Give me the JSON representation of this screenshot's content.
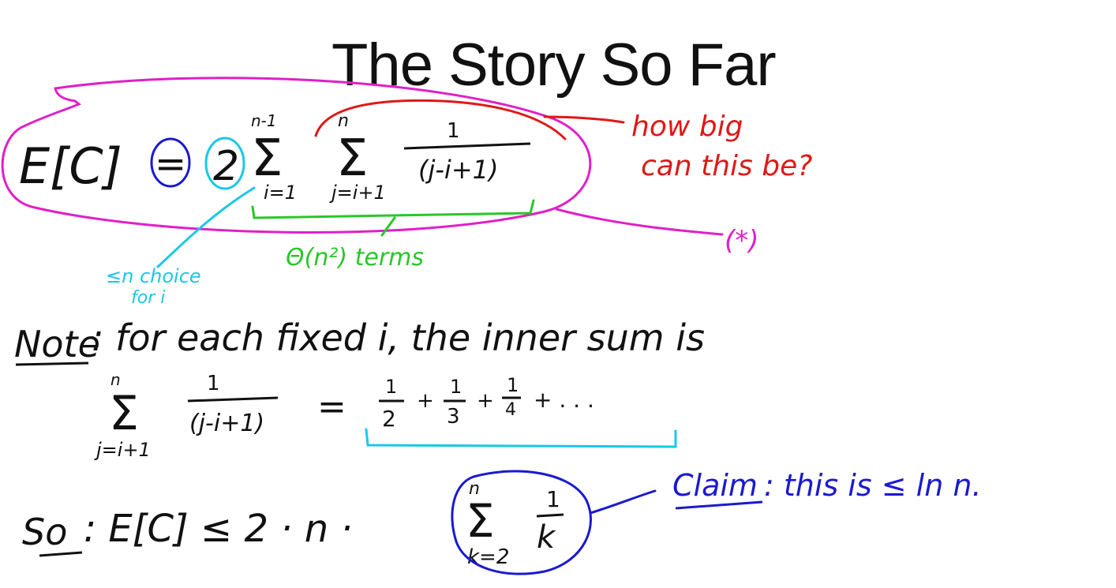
{
  "slide": {
    "title": "The Story So Far"
  },
  "ink": {
    "colors": {
      "black": "#111111",
      "magenta": "#e020c8",
      "red": "#e01818",
      "blue": "#1a1ad0",
      "cyan": "#18c8e8",
      "green": "#28c828"
    },
    "equation": {
      "lhs": "E[C]",
      "equals": "=",
      "factor": "2",
      "outer_sum_upper": "n-1",
      "outer_sum_lower": "i=1",
      "inner_sum_upper": "n",
      "inner_sum_lower": "j=i+1",
      "fraction_numerator": "1",
      "fraction_denominator": "(j-i+1)",
      "star_label": "(*)"
    },
    "annotations": {
      "how_big_line1": "how big",
      "how_big_line2": "can this be?",
      "terms": "Θ(n²) terms",
      "choice_line1": "≤n choice",
      "choice_line2": "for i"
    },
    "note": {
      "label": "Note",
      "text": ": for each fixed i, the inner sum is",
      "sum_upper": "n",
      "sum_lower": "j=i+1",
      "frac_num": "1",
      "frac_den": "(j-i+1)",
      "equals": "=",
      "series_num_1": "1",
      "series_den_1": "2",
      "plus_1": "+",
      "series_num_2": "1",
      "series_den_2": "3",
      "plus_2": "+",
      "series_num_3": "1",
      "series_den_3": "4",
      "tail": "+ . . ."
    },
    "so": {
      "label": "So",
      "text": ": E[C] ≤ 2 · n ·",
      "sum_upper": "n",
      "sum_lower": "k=2",
      "frac_num": "1",
      "frac_den": "k"
    },
    "claim": {
      "label": "Claim",
      "text": ": this is ≤ ln n."
    }
  }
}
